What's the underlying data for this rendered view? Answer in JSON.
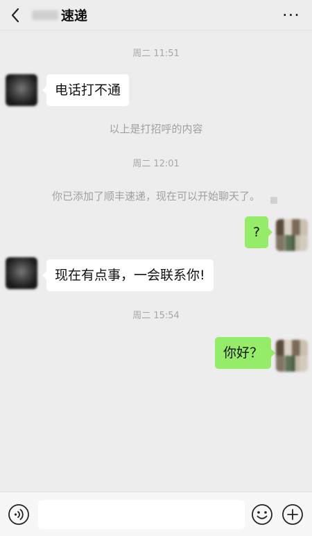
{
  "header": {
    "title": "速递",
    "back_icon": "chevron-left-icon",
    "more_label": "···"
  },
  "chat": {
    "timestamps": [
      "周二 11:51",
      "周二 12:01",
      "周二 15:54"
    ],
    "system_messages": [
      "以上是打招呼的内容",
      "你已添加了顺丰速递，现在可以开始聊天了。"
    ],
    "messages": [
      {
        "side": "in",
        "text": "电话打不通"
      },
      {
        "side": "out",
        "text": "?"
      },
      {
        "side": "in",
        "text": "现在有点事，一会联系你!"
      },
      {
        "side": "out",
        "text": "你好？"
      }
    ]
  },
  "input_bar": {
    "voice_icon": "voice-icon",
    "emoji_icon": "emoji-icon",
    "plus_icon": "plus-icon",
    "input_value": "",
    "input_placeholder": ""
  },
  "colors": {
    "background": "#ededed",
    "outgoing_bubble": "#95ec69",
    "incoming_bubble": "#ffffff",
    "system_text": "#a6a6a6"
  }
}
